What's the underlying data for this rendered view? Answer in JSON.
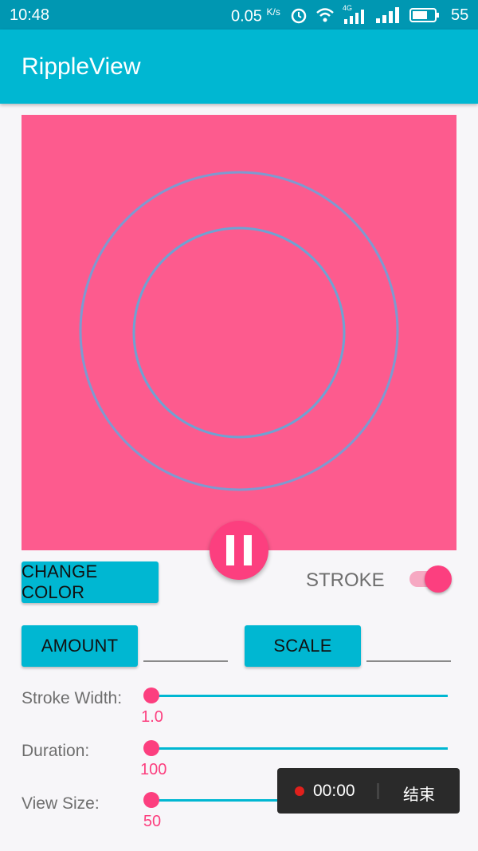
{
  "status_bar": {
    "time": "10:48",
    "net_speed": "0.05",
    "net_unit": "K/s",
    "network_type": "4G",
    "battery_level": "55",
    "icons": [
      "alarm-icon",
      "wifi-icon",
      "signal-4g-icon",
      "signal-icon",
      "battery-icon"
    ]
  },
  "app_bar": {
    "title": "RippleView"
  },
  "ripple": {
    "background_color": "#fd5b8e",
    "ring_color": "#7e9ad0",
    "play_state": "pause"
  },
  "controls": {
    "change_color_label": "CHANGE COLOR",
    "stroke_label": "STROKE",
    "stroke_enabled": true,
    "amount_label": "AMOUNT",
    "amount_value": "",
    "scale_label": "SCALE",
    "scale_value": ""
  },
  "sliders": [
    {
      "label": "Stroke Width:",
      "value": "1.0"
    },
    {
      "label": "Duration:",
      "value": "100"
    },
    {
      "label": "View Size:",
      "value": "50"
    }
  ],
  "recorder": {
    "timer": "00:00",
    "end_label": "结束"
  },
  "colors": {
    "accent": "#00b7d2",
    "status_bar": "#0097b2",
    "pink": "#fc3f7f"
  }
}
